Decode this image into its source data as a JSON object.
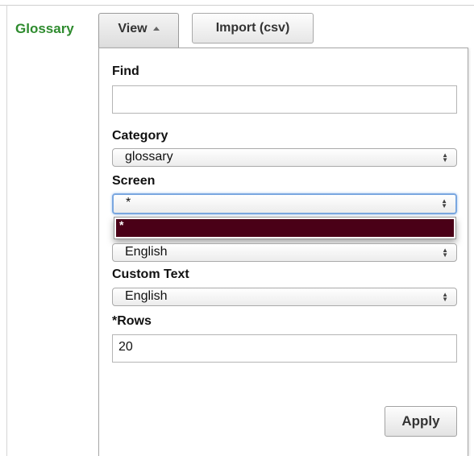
{
  "header": {
    "title": "Glossary",
    "view_label": "View",
    "import_label": "Import (csv)"
  },
  "panel": {
    "find": {
      "label": "Find",
      "value": ""
    },
    "category": {
      "label": "Category",
      "selected": "glossary"
    },
    "screen": {
      "label": "Screen",
      "selected": "*",
      "open_option": "*"
    },
    "language": {
      "selected": "English"
    },
    "custom_text": {
      "label": "Custom Text",
      "selected": "English"
    },
    "rows": {
      "label": "*Rows",
      "value": "20"
    },
    "apply_label": "Apply"
  },
  "colors": {
    "title": "#2e8b2e",
    "highlight": "#4a0017",
    "focus": "#7aa7e0"
  },
  "icons": [
    "caret-up-icon",
    "updown-arrows-icon"
  ]
}
